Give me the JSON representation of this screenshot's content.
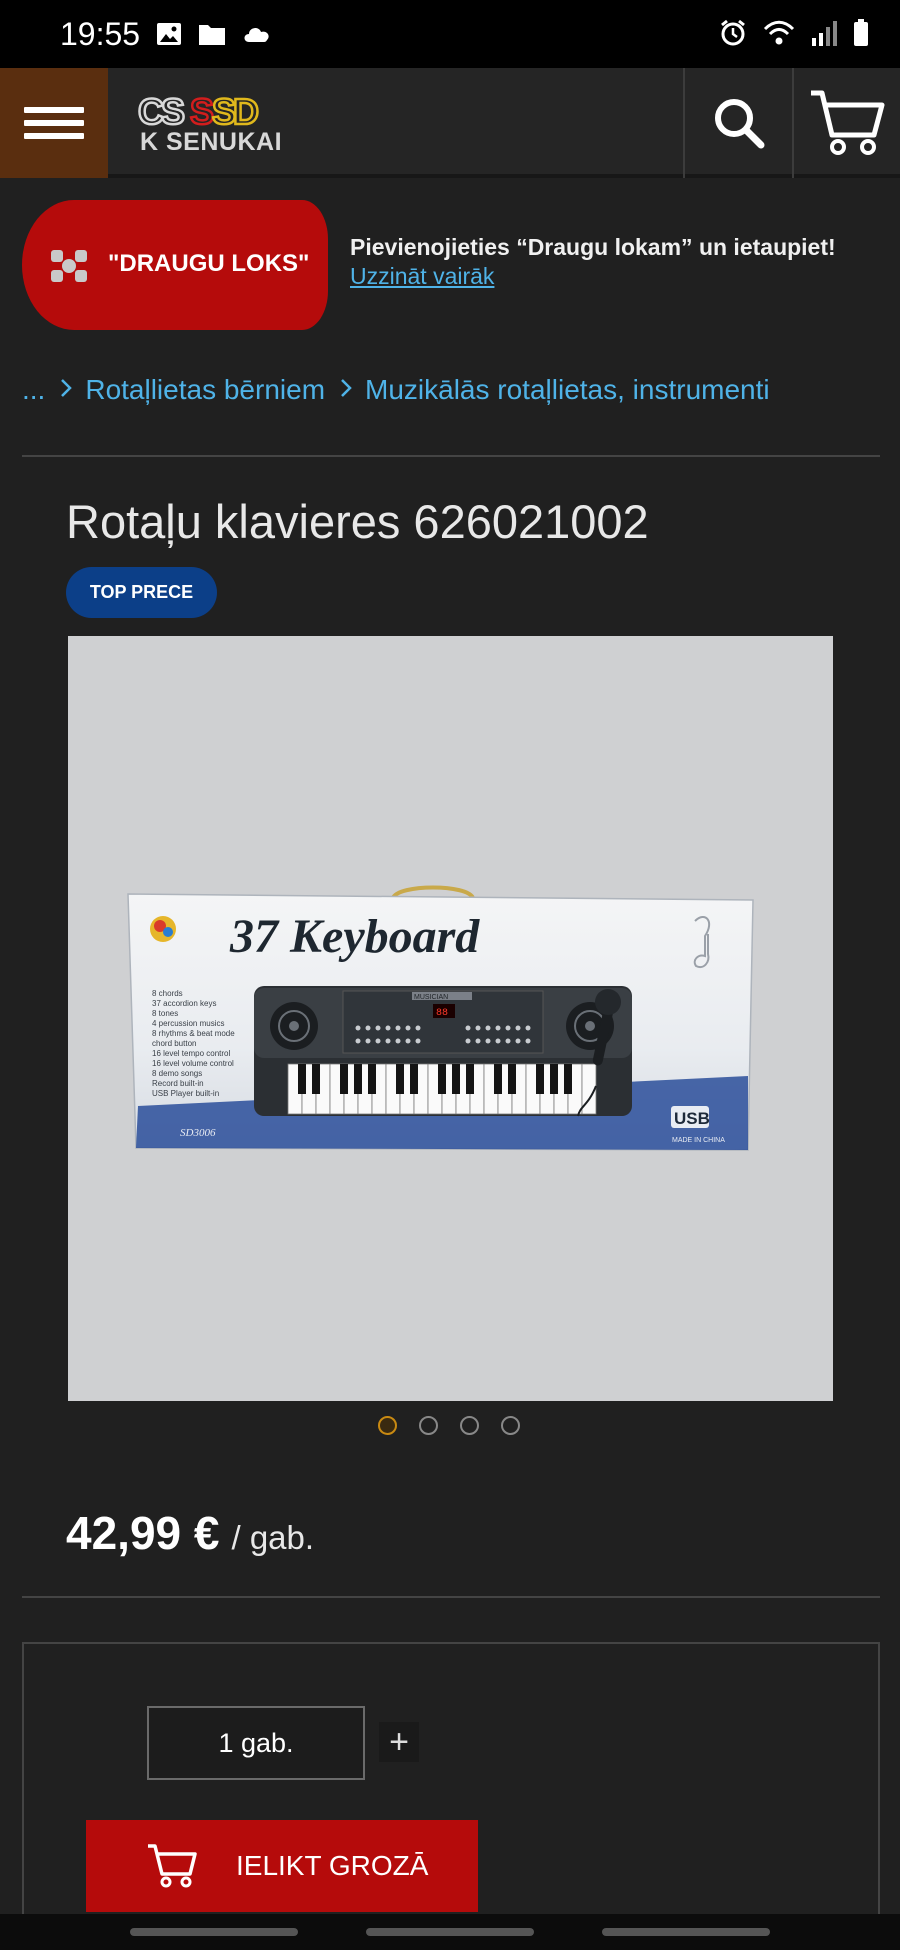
{
  "status_bar": {
    "time": "19:55"
  },
  "header": {
    "logo_top": "CSSSD",
    "logo_brand": "K SENUKAI"
  },
  "promo": {
    "badge": "\"DRAUGU LOKS\"",
    "text": "Pievienojieties “Draugu lokam” un ietaupiet!",
    "link": "Uzzināt vairāk"
  },
  "breadcrumb": {
    "ellipsis": "...",
    "items": [
      "Rotaļlietas bērniem",
      "Muzikālās rotaļlietas, instrumenti"
    ]
  },
  "product": {
    "title": "Rotaļu klavieres 626021002",
    "badge": "TOP PRECE",
    "image": {
      "heading": "37 Keyboard",
      "model": "SD3006",
      "usb": "USB",
      "made_in": "MADE IN CHINA",
      "musician": "MUSICIAN",
      "features": [
        "8 chords",
        "37 accordion keys",
        "8 tones",
        "4 percussion musics",
        "8 rhythms & beat mode",
        "chord button",
        "16 level tempo control",
        "16 level volume control",
        "8 demo songs",
        "Record built-in",
        "USB Player built-in"
      ]
    },
    "image_count": 4,
    "active_image": 1,
    "price": "42,99 €",
    "unit": "/ gab."
  },
  "purchase": {
    "quantity": "1 gab.",
    "plus": "+",
    "add_to_cart": "IELIKT GROZĀ"
  },
  "colors": {
    "background": "#202020",
    "accent_red": "#b50b0b",
    "link_blue": "#4fb3e8",
    "badge_blue": "#0c3f88",
    "menu_brown": "#5a2e0f"
  }
}
